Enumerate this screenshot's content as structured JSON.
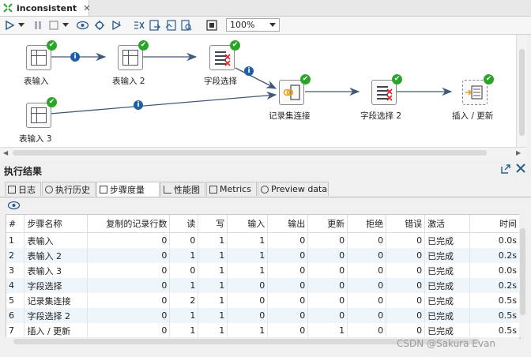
{
  "editor_tab": {
    "label": "inconsistent",
    "close": "✕"
  },
  "toolbar": {
    "zoom_value": "100%"
  },
  "canvas": {
    "steps": [
      {
        "label": "表输入"
      },
      {
        "label": "表输入 2"
      },
      {
        "label": "字段选择"
      },
      {
        "label": "表输入 3"
      },
      {
        "label": "记录集连接"
      },
      {
        "label": "字段选择 2"
      },
      {
        "label": "插入 / 更新"
      }
    ],
    "info_glyph": "i",
    "check_glyph": "✔"
  },
  "results": {
    "title": "执行结果",
    "tabs": [
      {
        "label": "日志"
      },
      {
        "label": "执行历史"
      },
      {
        "label": "步骤度量"
      },
      {
        "label": "性能图"
      },
      {
        "label": "Metrics"
      },
      {
        "label": "Preview data"
      }
    ],
    "columns": [
      "#",
      "步骤名称",
      "复制的记录行数",
      "读",
      "写",
      "输入",
      "输出",
      "更新",
      "拒绝",
      "错误",
      "激活",
      "时间"
    ],
    "rows": [
      [
        "1",
        "表输入",
        "0",
        "0",
        "1",
        "1",
        "0",
        "0",
        "0",
        "0",
        "已完成",
        "0.0s"
      ],
      [
        "2",
        "表输入 2",
        "0",
        "1",
        "1",
        "1",
        "0",
        "0",
        "0",
        "0",
        "已完成",
        "0.2s"
      ],
      [
        "3",
        "表输入 3",
        "0",
        "0",
        "1",
        "1",
        "0",
        "0",
        "0",
        "0",
        "已完成",
        "0.0s"
      ],
      [
        "4",
        "字段选择",
        "0",
        "1",
        "1",
        "0",
        "0",
        "0",
        "0",
        "0",
        "已完成",
        "0.2s"
      ],
      [
        "5",
        "记录集连接",
        "0",
        "2",
        "1",
        "0",
        "0",
        "0",
        "0",
        "0",
        "已完成",
        "0.5s"
      ],
      [
        "6",
        "字段选择 2",
        "0",
        "1",
        "1",
        "0",
        "0",
        "0",
        "0",
        "0",
        "已完成",
        "0.5s"
      ],
      [
        "7",
        "插入 / 更新",
        "0",
        "1",
        "1",
        "1",
        "0",
        "1",
        "0",
        "0",
        "已完成",
        "0.5s"
      ]
    ]
  },
  "watermark": "CSDN @Sakura Evan"
}
